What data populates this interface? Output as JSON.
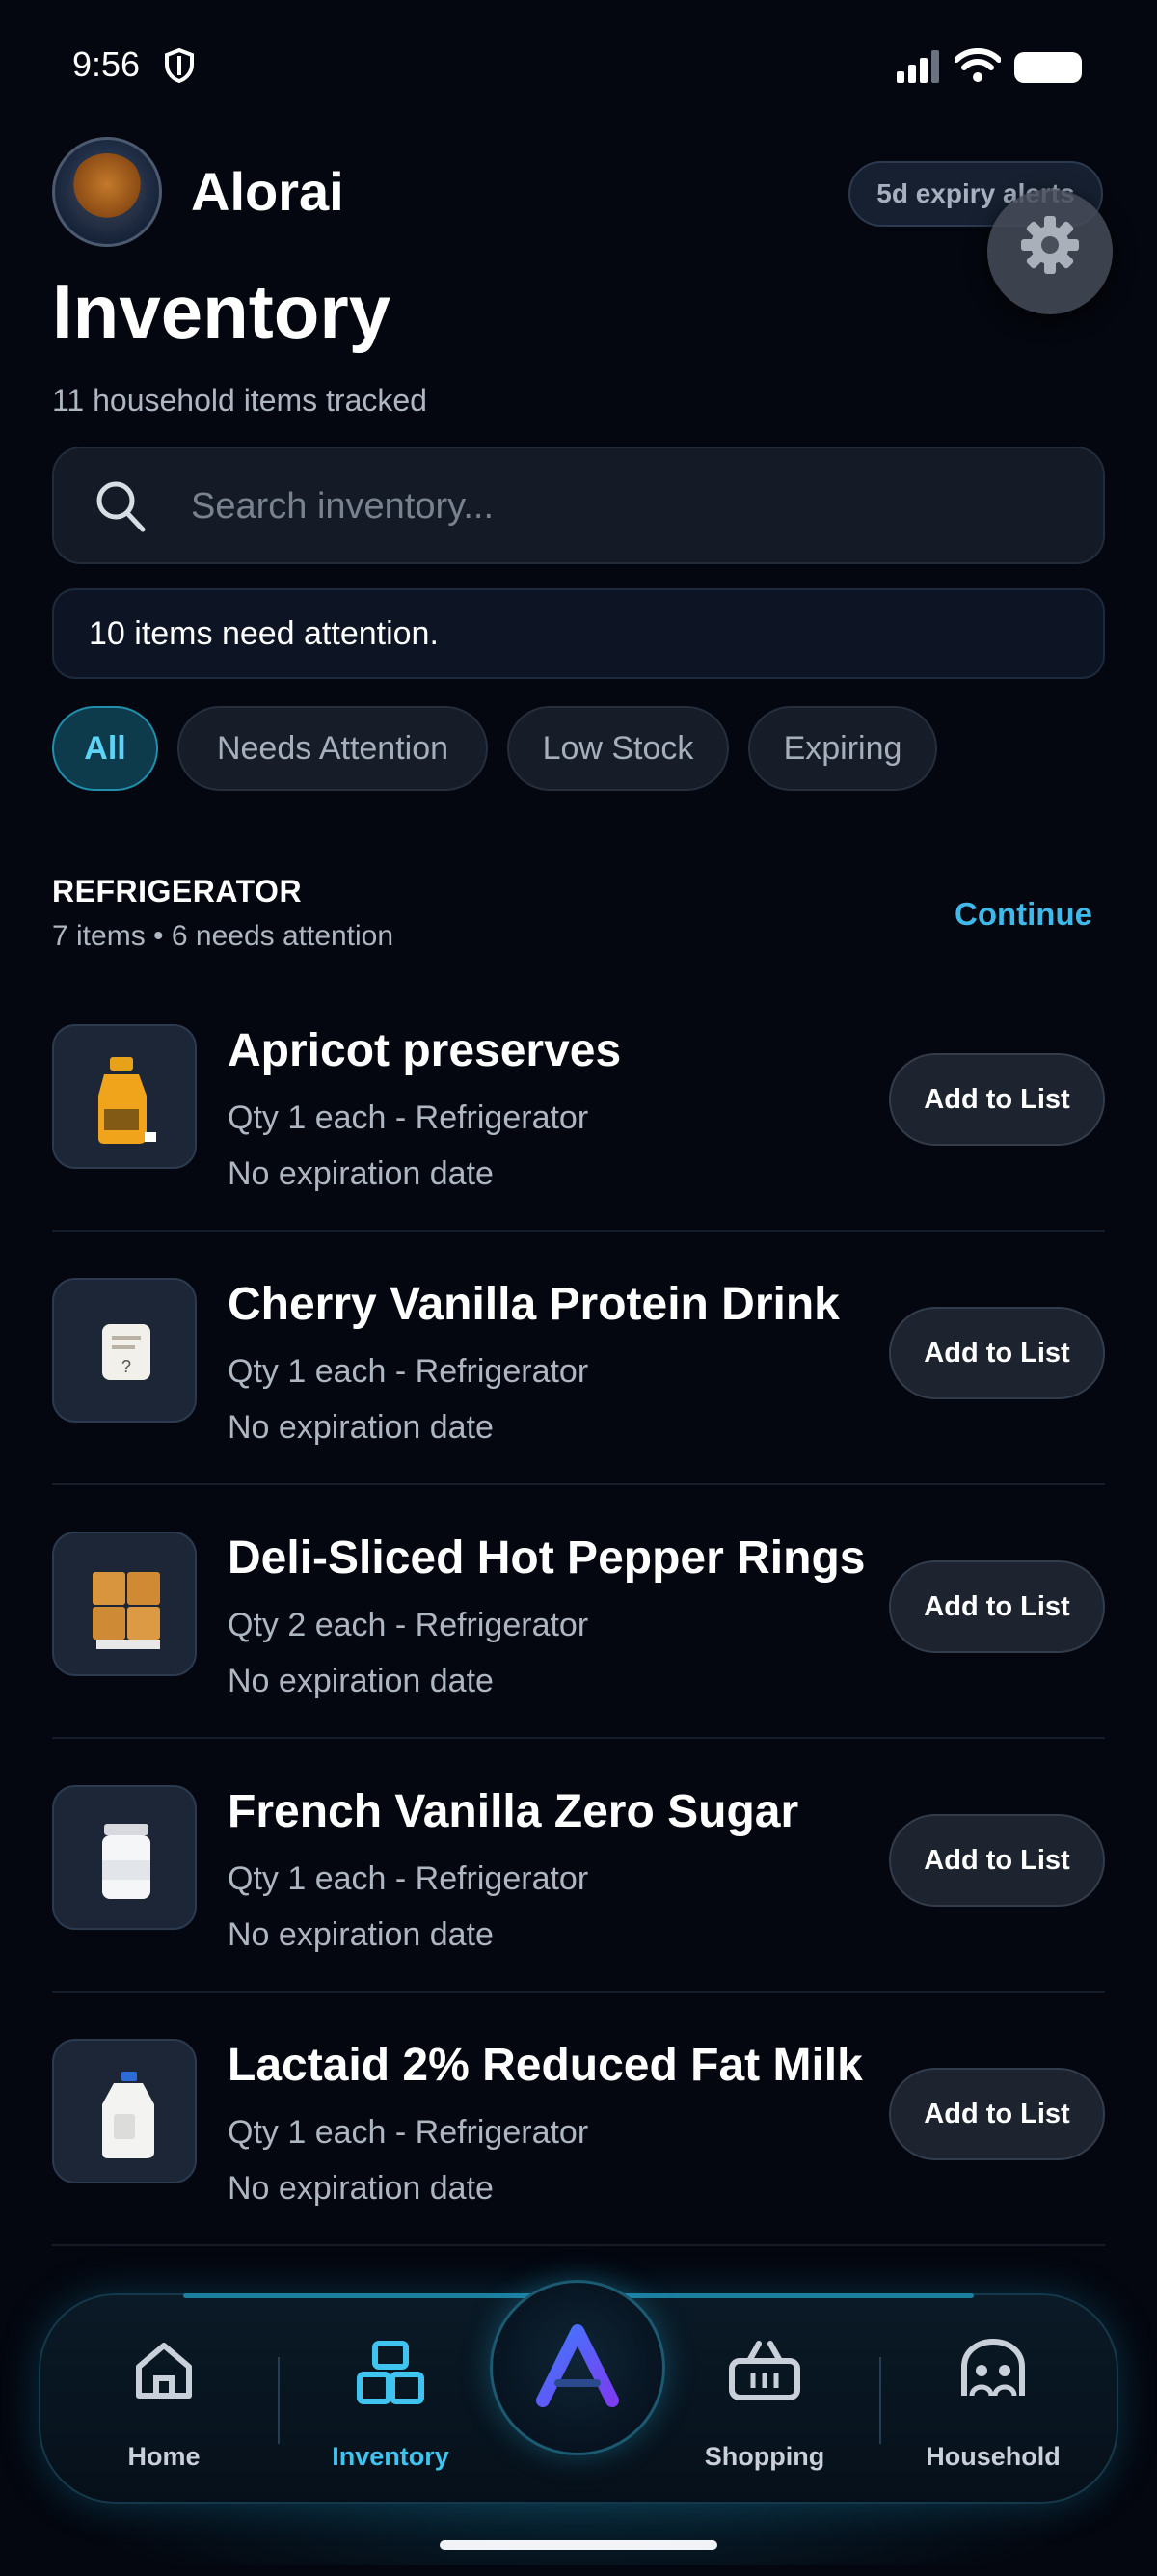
{
  "status_bar": {
    "time": "9:56"
  },
  "header": {
    "app_name": "Alorai",
    "expiry_alert": "5d expiry alerts",
    "title": "Inventory",
    "subtitle": "11 household items tracked"
  },
  "search": {
    "placeholder": "Search inventory..."
  },
  "attention_banner": "10 items need attention.",
  "filters": [
    "All",
    "Needs Attention",
    "Low Stock",
    "Expiring"
  ],
  "section": {
    "title": "REFRIGERATOR",
    "meta": "7 items • 6 needs attention",
    "action": "Continue"
  },
  "items": [
    {
      "name": "Apricot preserves",
      "qty": "Qty 1 each - Refrigerator",
      "expiry": "No expiration date",
      "action": "Add to List",
      "icon": "juice-bottle-icon"
    },
    {
      "name": "Cherry Vanilla Protein Drink",
      "qty": "Qty 1 each - Refrigerator",
      "expiry": "No expiration date",
      "action": "Add to List",
      "icon": "unknown-item-icon"
    },
    {
      "name": "Deli-Sliced Hot Pepper Rings",
      "qty": "Qty 2 each - Refrigerator",
      "expiry": "No expiration date",
      "action": "Add to List",
      "icon": "crackers-icon"
    },
    {
      "name": "French Vanilla Zero Sugar",
      "qty": "Qty 1 each - Refrigerator",
      "expiry": "No expiration date",
      "action": "Add to List",
      "icon": "cream-jar-icon"
    },
    {
      "name": "Lactaid 2% Reduced Fat Milk",
      "qty": "Qty 1 each - Refrigerator",
      "expiry": "No expiration date",
      "action": "Add to List",
      "icon": "milk-jug-icon"
    }
  ],
  "nav": {
    "home": "Home",
    "inventory": "Inventory",
    "shopping": "Shopping",
    "household": "Household"
  },
  "colors": {
    "accent": "#3fc4f0",
    "background": "#04070f"
  }
}
